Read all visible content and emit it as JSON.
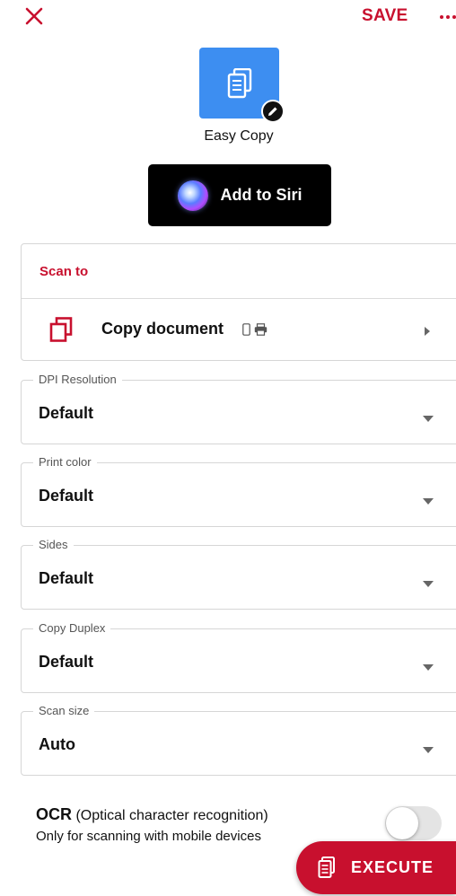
{
  "topbar": {
    "close_icon": "close-icon",
    "save_label": "SAVE",
    "more_icon": "more-horizontal-icon"
  },
  "shortcut": {
    "name": "Easy Copy",
    "tile_color": "#3d8ef1",
    "icon": "document-copy-icon",
    "edit_icon": "pencil-icon"
  },
  "siri": {
    "label": "Add to Siri",
    "icon": "siri-orb-icon"
  },
  "scan_to": {
    "title": "Scan to",
    "destination": {
      "label": "Copy document",
      "icon": "copy-icon",
      "device_icons": [
        "phone-icon",
        "printer-icon"
      ]
    }
  },
  "fields": [
    {
      "label": "DPI Resolution",
      "value": "Default"
    },
    {
      "label": "Print color",
      "value": "Default"
    },
    {
      "label": "Sides",
      "value": "Default"
    },
    {
      "label": "Copy Duplex",
      "value": "Default"
    },
    {
      "label": "Scan size",
      "value": "Auto"
    }
  ],
  "ocr": {
    "title_bold": "OCR",
    "title_rest": " (Optical character recognition)",
    "subtitle": "Only for scanning with mobile devices",
    "enabled": false
  },
  "execute": {
    "label": "EXECUTE",
    "icon": "document-icon"
  },
  "colors": {
    "accent": "#c8102e",
    "tile": "#3d8ef1",
    "siri_bg": "#000000"
  }
}
